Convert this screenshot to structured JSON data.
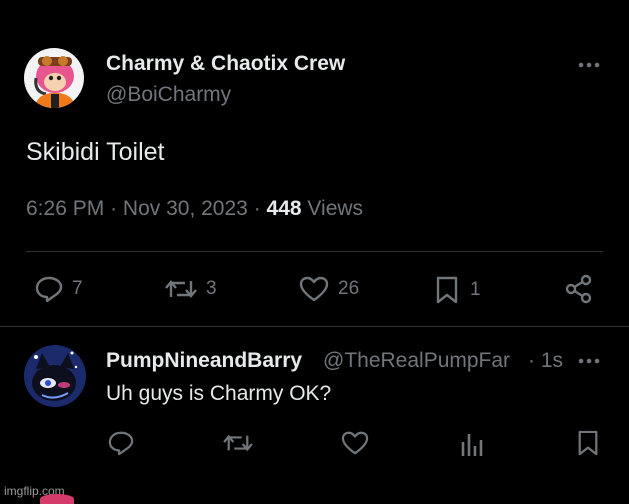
{
  "main_post": {
    "display_name": "Charmy & Chaotix Crew",
    "handle": "@BoiCharmy",
    "text": "Skibidi Toilet",
    "time": "6:26 PM",
    "dot1": "·",
    "date": "Nov 30, 2023",
    "dot2": "·",
    "views_count": "448",
    "views_label": "Views",
    "more_icon": "more-horizontal-icon",
    "actions": {
      "reply_count": "7",
      "repost_count": "3",
      "like_count": "26",
      "bookmark_count": "1"
    }
  },
  "reply": {
    "display_name": "PumpNineandBarry",
    "handle": "@TheRealPumpFar",
    "dot": "·",
    "time": "1s",
    "text": "Uh guys is Charmy OK?"
  },
  "watermark": "imgflip.com",
  "colors": {
    "background": "#000000",
    "text": "#e7e9ea",
    "secondary": "#71767b",
    "divider": "#2f3336"
  }
}
